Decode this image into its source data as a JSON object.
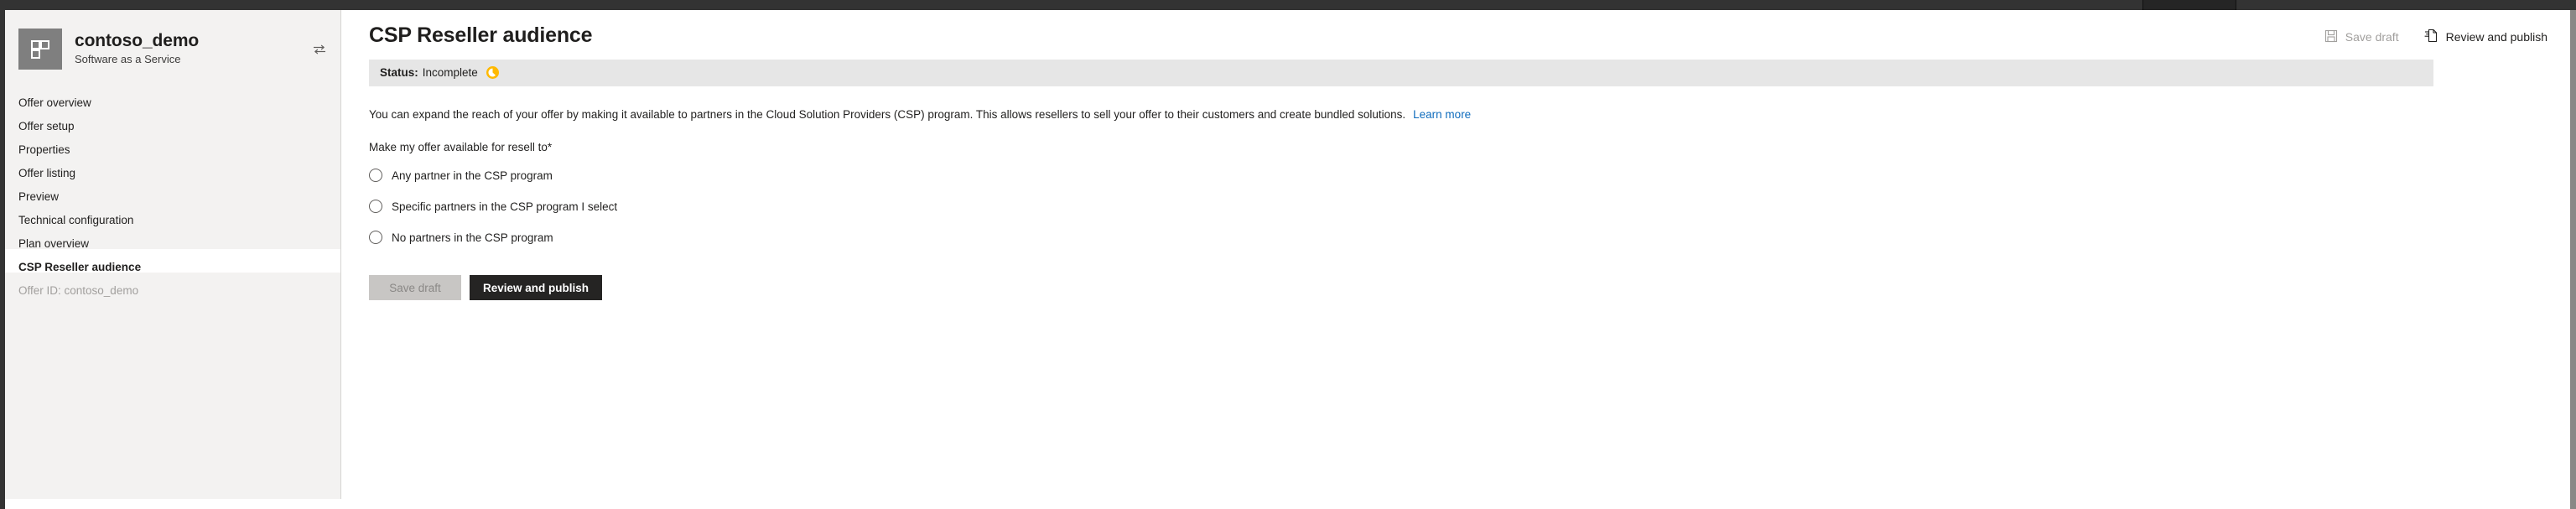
{
  "topbar": {
    "active_tab_present": true,
    "background_color": "#333333",
    "active_tab_color": "#252525"
  },
  "sidebar": {
    "offer": {
      "name": "contoso_demo",
      "type": "Software as a Service",
      "logo_icon": "grid-squares-icon",
      "switch_icon": "swap-arrows-icon"
    },
    "items": [
      {
        "label": "Offer overview",
        "state": "normal"
      },
      {
        "label": "Offer setup",
        "state": "normal"
      },
      {
        "label": "Properties",
        "state": "normal"
      },
      {
        "label": "Offer listing",
        "state": "normal"
      },
      {
        "label": "Preview",
        "state": "normal"
      },
      {
        "label": "Technical configuration",
        "state": "normal"
      },
      {
        "label": "Plan overview",
        "state": "normal"
      },
      {
        "label": "CSP Reseller audience",
        "state": "selected"
      },
      {
        "label": "Offer ID: contoso_demo",
        "state": "disabled"
      }
    ]
  },
  "header": {
    "title": "CSP Reseller audience",
    "commands": [
      {
        "label": "Save draft",
        "icon": "save-disk-icon",
        "enabled": false
      },
      {
        "label": "Review and publish",
        "icon": "publish-document-icon",
        "enabled": true
      }
    ]
  },
  "status": {
    "label": "Status:",
    "value": "Incomplete",
    "icon": "clock-pending-icon",
    "icon_color": "#ffb900",
    "background": "#e6e6e6"
  },
  "main": {
    "intro_text": "You can expand the reach of your offer by making it available to partners in the Cloud Solution Providers (CSP) program. This allows resellers to sell your offer to their customers and create bundled solutions.",
    "learn_more_label": "Learn more",
    "learn_more_color": "#0f6cbd",
    "field_label": "Make my offer available for resell to",
    "required_marker": "*",
    "radio_options": [
      {
        "label": "Any partner in the CSP program",
        "selected": false
      },
      {
        "label": "Specific partners in the CSP program I select",
        "selected": false
      },
      {
        "label": "No partners in the CSP program",
        "selected": false
      }
    ],
    "footer_buttons": [
      {
        "label": "Save draft",
        "style": "secondary-disabled"
      },
      {
        "label": "Review and publish",
        "style": "primary"
      }
    ]
  }
}
